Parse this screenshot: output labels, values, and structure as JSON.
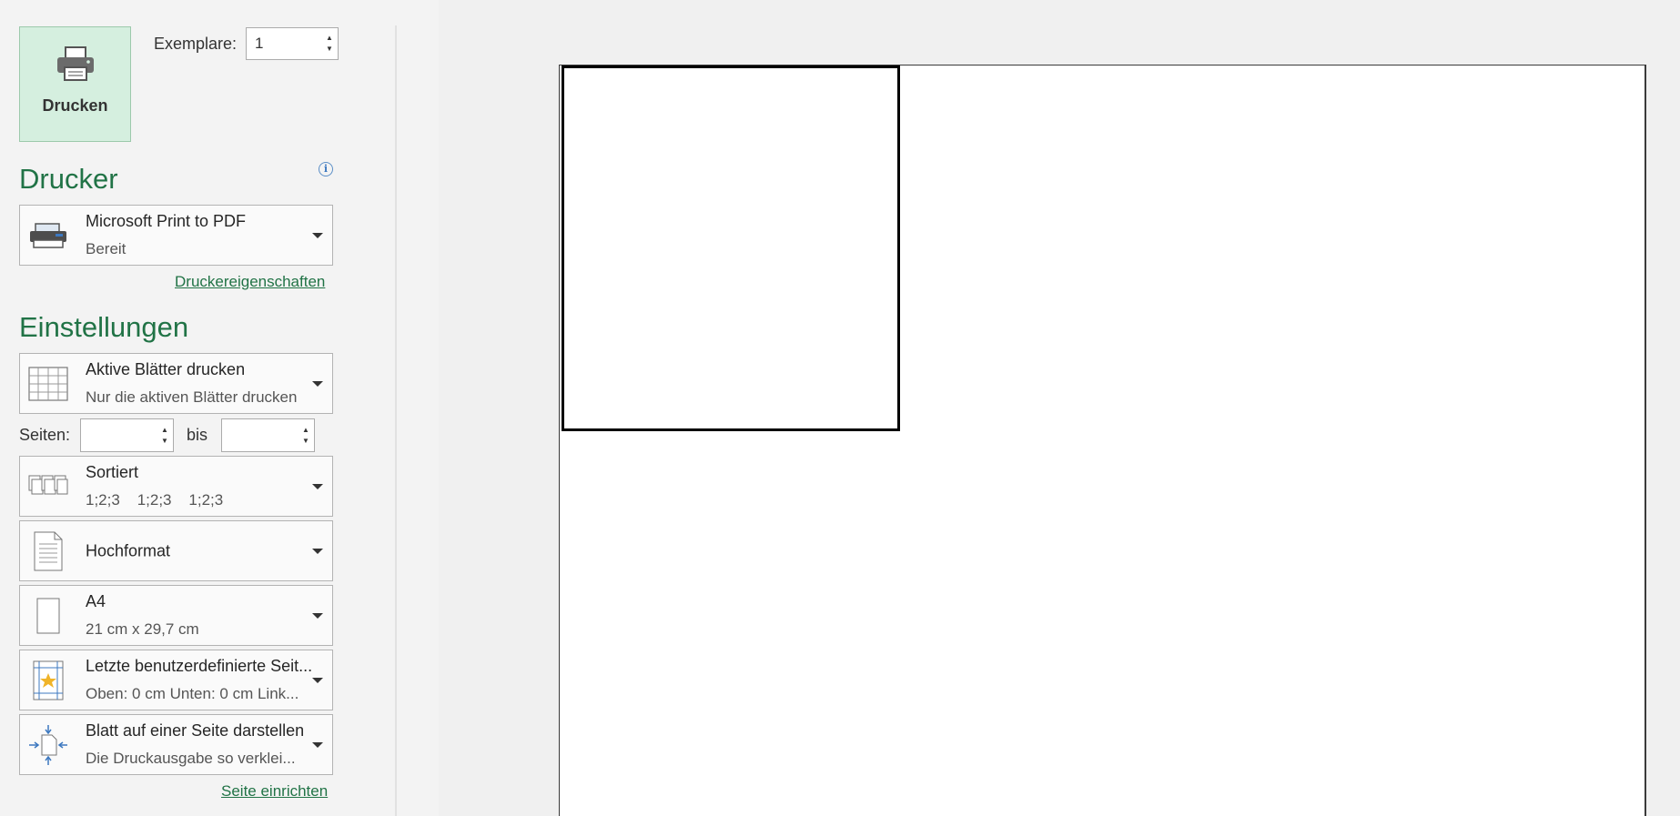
{
  "print_button": {
    "label": "Drucken",
    "icon": "printer-icon"
  },
  "copies": {
    "label": "Exemplare:",
    "value": "1"
  },
  "printer_section": {
    "title": "Drucker",
    "info_icon": "info-icon",
    "printer": {
      "name": "Microsoft Print to PDF",
      "status": "Bereit",
      "icon": "printer-device-icon"
    },
    "properties_link": "Druckereigenschaften"
  },
  "settings_section": {
    "title": "Einstellungen",
    "print_what": {
      "line1": "Aktive Blätter drucken",
      "line2": "Nur die aktiven Blätter drucken",
      "icon": "sheet-grid-icon"
    },
    "pages": {
      "label": "Seiten:",
      "from": "",
      "to_label": "bis",
      "to": ""
    },
    "collation": {
      "line1": "Sortiert",
      "line2": "1;2;3    1;2;3    1;2;3",
      "icon": "collated-pages-icon"
    },
    "orientation": {
      "label": "Hochformat",
      "icon": "portrait-page-icon"
    },
    "paper_size": {
      "line1": "A4",
      "line2": "21 cm x 29,7 cm",
      "icon": "paper-size-icon"
    },
    "margins": {
      "line1": "Letzte benutzerdefinierte Seit...",
      "line2": "Oben: 0 cm Unten: 0 cm Link...",
      "icon": "custom-margins-icon"
    },
    "scaling": {
      "line1": "Blatt auf einer Seite darstellen",
      "line2": "Die Druckausgabe so verklei...",
      "icon": "fit-to-page-icon"
    },
    "page_setup_link": "Seite einrichten"
  },
  "colors": {
    "accent": "#217346",
    "print_button_bg": "#d5efdf"
  }
}
